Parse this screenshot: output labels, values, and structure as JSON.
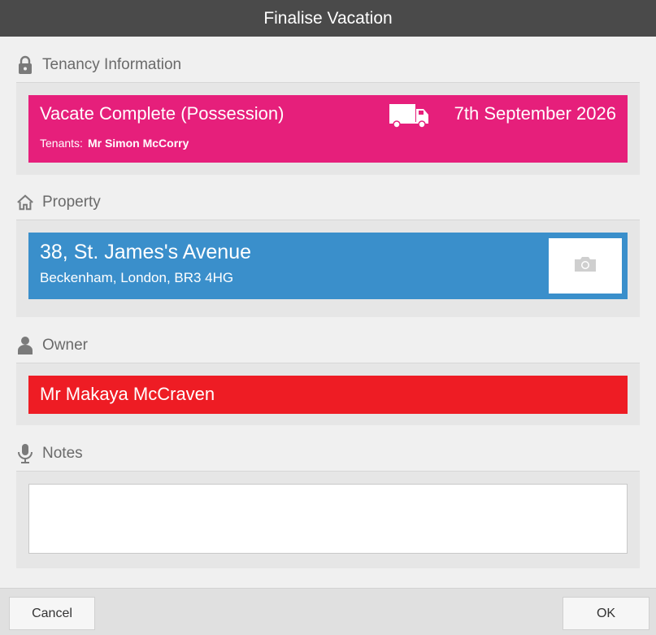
{
  "window": {
    "title": "Finalise Vacation"
  },
  "sections": {
    "tenancy": {
      "heading": "Tenancy Information",
      "icon": "lock-icon"
    },
    "property": {
      "heading": "Property",
      "icon": "home-icon"
    },
    "owner": {
      "heading": "Owner",
      "icon": "person-icon"
    },
    "notes": {
      "heading": "Notes",
      "icon": "microphone-icon"
    }
  },
  "tenancy": {
    "status": "Vacate Complete (Possession)",
    "date": "7th September 2026",
    "tenants_label": "Tenants:",
    "tenants_value": "Mr Simon McCorry",
    "icon": "truck-icon",
    "color": "#e61f7b"
  },
  "property": {
    "address_line1": "38, St. James's Avenue",
    "address_line2": "Beckenham, London, BR3 4HG",
    "photo_icon": "camera-icon",
    "color": "#3a8fcb"
  },
  "owner": {
    "name": "Mr Makaya McCraven",
    "color": "#ee1c24"
  },
  "notes": {
    "value": ""
  },
  "footer": {
    "cancel_label": "Cancel",
    "ok_label": "OK"
  }
}
